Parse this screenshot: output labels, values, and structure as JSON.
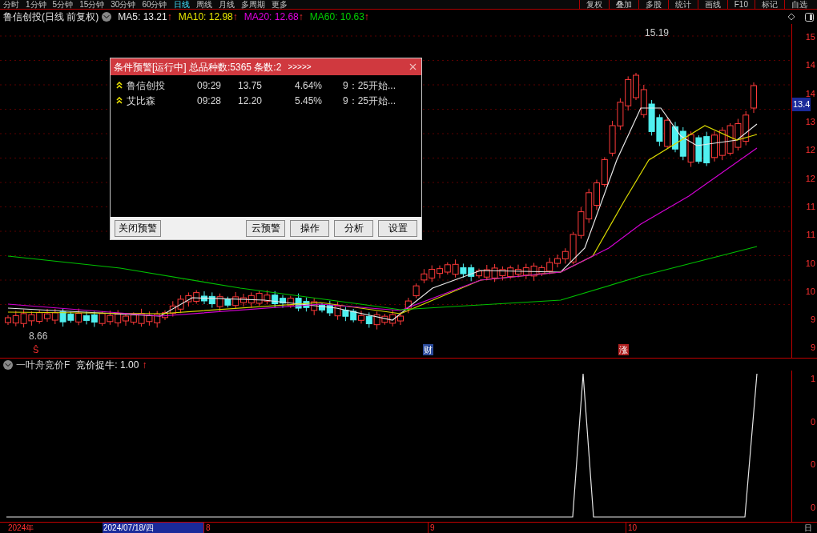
{
  "toolbar": {
    "periods": [
      {
        "label": "分时",
        "selected": false
      },
      {
        "label": "1分钟",
        "selected": false
      },
      {
        "label": "5分钟",
        "selected": false
      },
      {
        "label": "15分钟",
        "selected": false
      },
      {
        "label": "30分钟",
        "selected": false
      },
      {
        "label": "60分钟",
        "selected": false
      },
      {
        "label": "日线",
        "selected": true
      },
      {
        "label": "周线",
        "selected": false
      },
      {
        "label": "月线",
        "selected": false
      },
      {
        "label": "多周期",
        "selected": false
      },
      {
        "label": "更多",
        "selected": false
      }
    ],
    "tools": [
      "复权",
      "叠加",
      "多股",
      "统计",
      "画线",
      "F10",
      "标记",
      "自选"
    ]
  },
  "header": {
    "title": "鲁信创投(日线 前复权)",
    "averages": [
      {
        "label": "MA5: 13.21",
        "trend": "↑",
        "color": "#e8e8e8"
      },
      {
        "label": "MA10: 12.98",
        "trend": "↑",
        "color": "#e8e800"
      },
      {
        "label": "MA20: 12.68",
        "trend": "↑",
        "color": "#e000e0"
      },
      {
        "label": "MA60: 10.63",
        "trend": "↑",
        "color": "#00d000"
      }
    ]
  },
  "chart": {
    "high_label": "15.19",
    "low_label": "8.66",
    "price_tag": "13.4",
    "markers": [
      {
        "text": "Ŝ",
        "kind": "signal"
      },
      {
        "text": "财",
        "kind": "finance"
      },
      {
        "text": "涨",
        "kind": "limit"
      }
    ],
    "axis_labels": [
      "15",
      "14",
      "14",
      "13",
      "12",
      "12",
      "11",
      "11",
      "10",
      "10",
      "9",
      "9"
    ]
  },
  "alert_dialog": {
    "title": "条件预警[运行中] 总品种数:5365 条数:2",
    "arrows": ">>>>>",
    "rows": [
      {
        "name": "鲁信创投",
        "time": "09:29",
        "price": "13.75",
        "change": "4.64%",
        "note": "9：25开始..."
      },
      {
        "name": "艾比森",
        "time": "09:28",
        "price": "12.20",
        "change": "5.45%",
        "note": "9：25开始..."
      }
    ],
    "close_button": "关闭预警",
    "buttons": [
      "云预警",
      "操作",
      "分析",
      "设置"
    ]
  },
  "indicator": {
    "name": "一叶舟竞价F",
    "value": "竞价捉牛: 1.00",
    "trend": "↑",
    "axis_labels": [
      "1",
      "0",
      "0",
      "0"
    ]
  },
  "date_axis": {
    "year": "2024年",
    "cursor_date": "2024/07/18/四",
    "months": [
      "8",
      "9",
      "10"
    ],
    "period": "日"
  }
}
